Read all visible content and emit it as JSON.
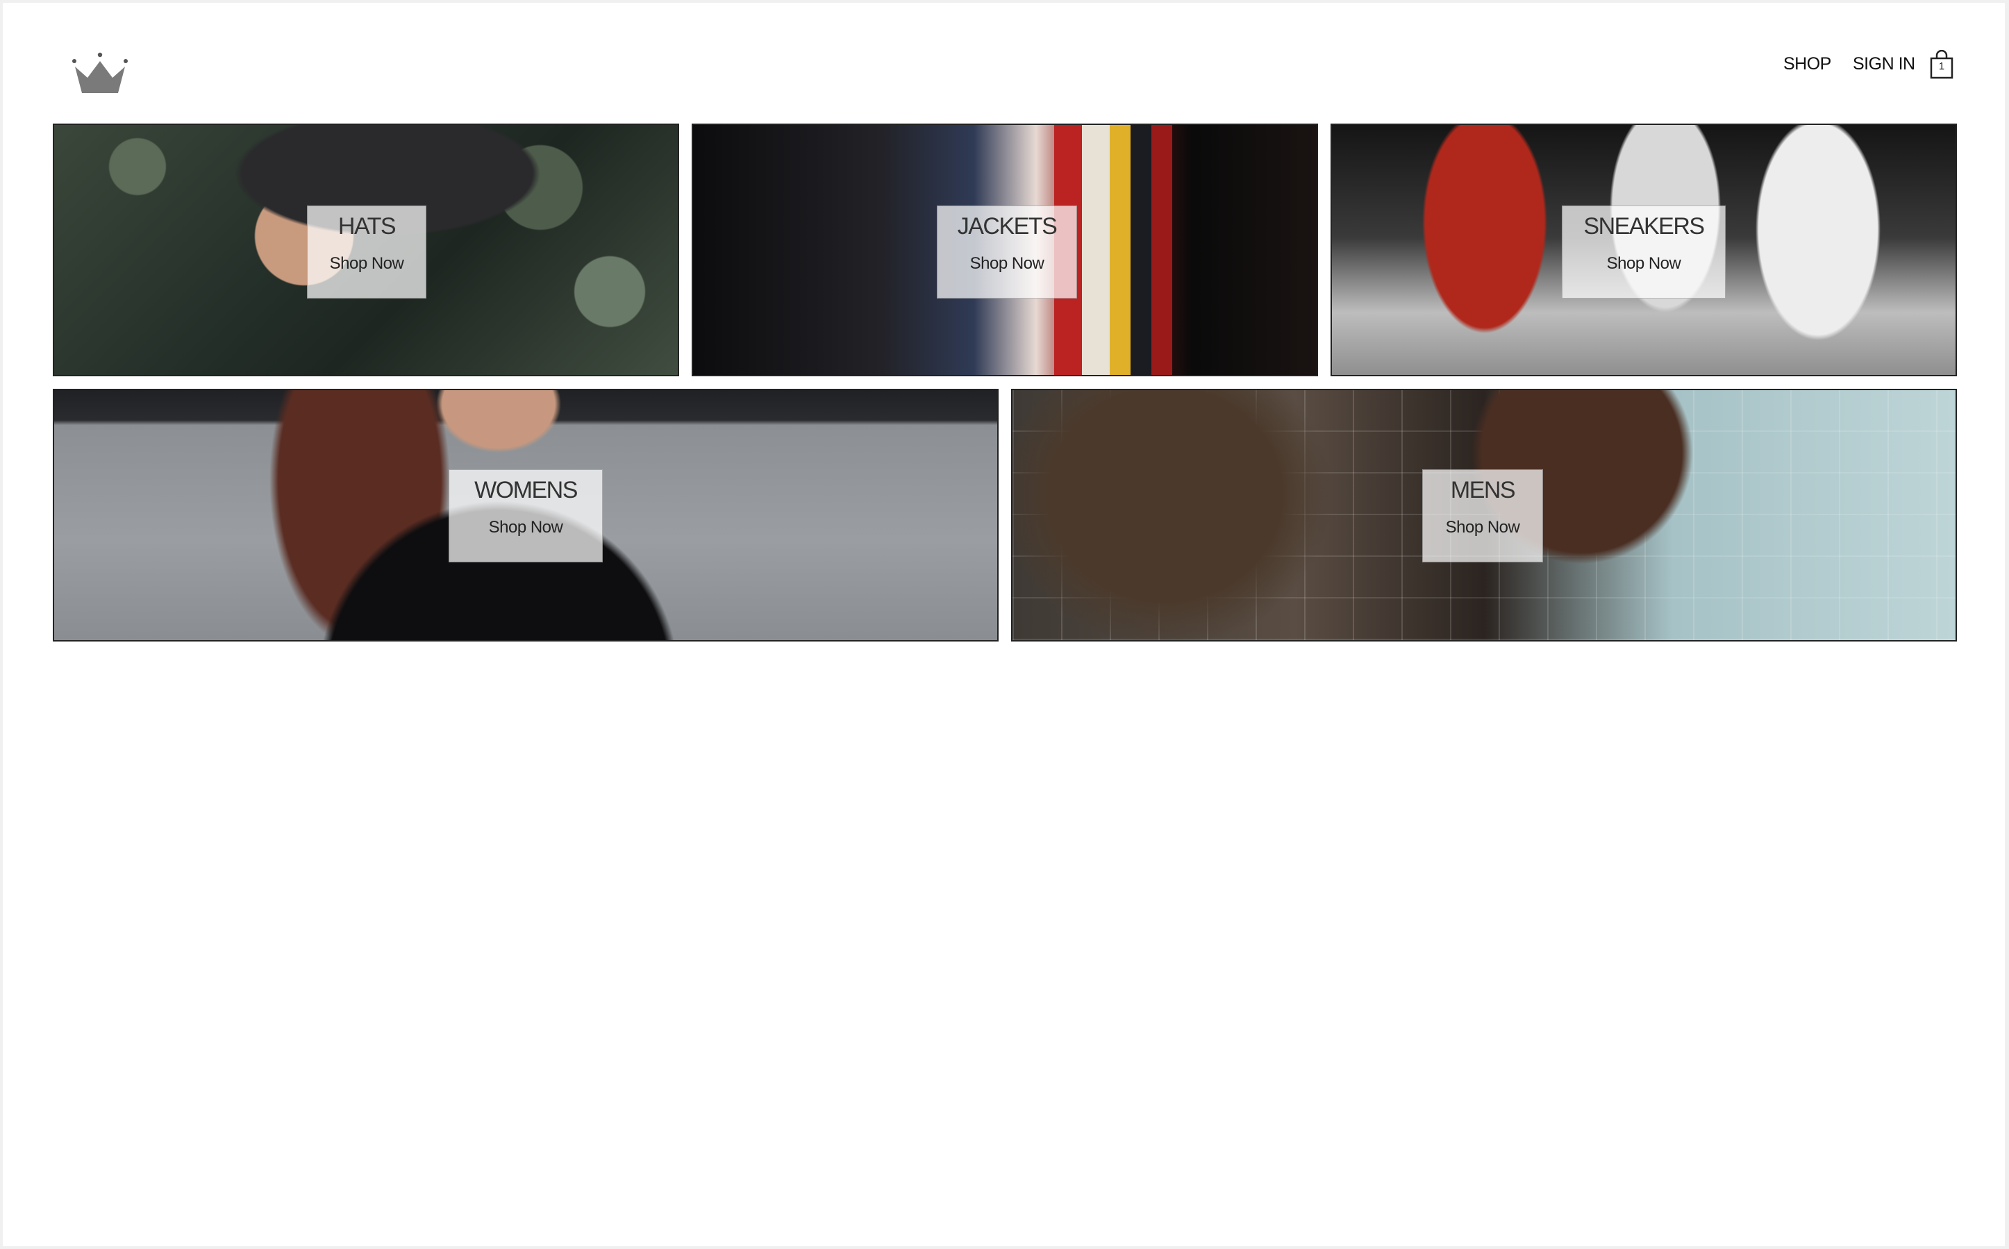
{
  "header": {
    "logo_icon": "crown-icon",
    "nav": {
      "shop": "SHOP",
      "sign_in": "SIGN IN"
    },
    "cart": {
      "icon": "shopping-bag-icon",
      "count": "1"
    }
  },
  "categories": [
    {
      "title": "HATS",
      "cta": "Shop Now"
    },
    {
      "title": "JACKETS",
      "cta": "Shop Now"
    },
    {
      "title": "SNEAKERS",
      "cta": "Shop Now"
    },
    {
      "title": "WOMENS",
      "cta": "Shop Now"
    },
    {
      "title": "MENS",
      "cta": "Shop Now"
    }
  ],
  "colors": {
    "background": "#ffffff",
    "text": "#111111",
    "tile_border": "#222222",
    "label_bg": "rgba(255,255,255,0.72)"
  }
}
